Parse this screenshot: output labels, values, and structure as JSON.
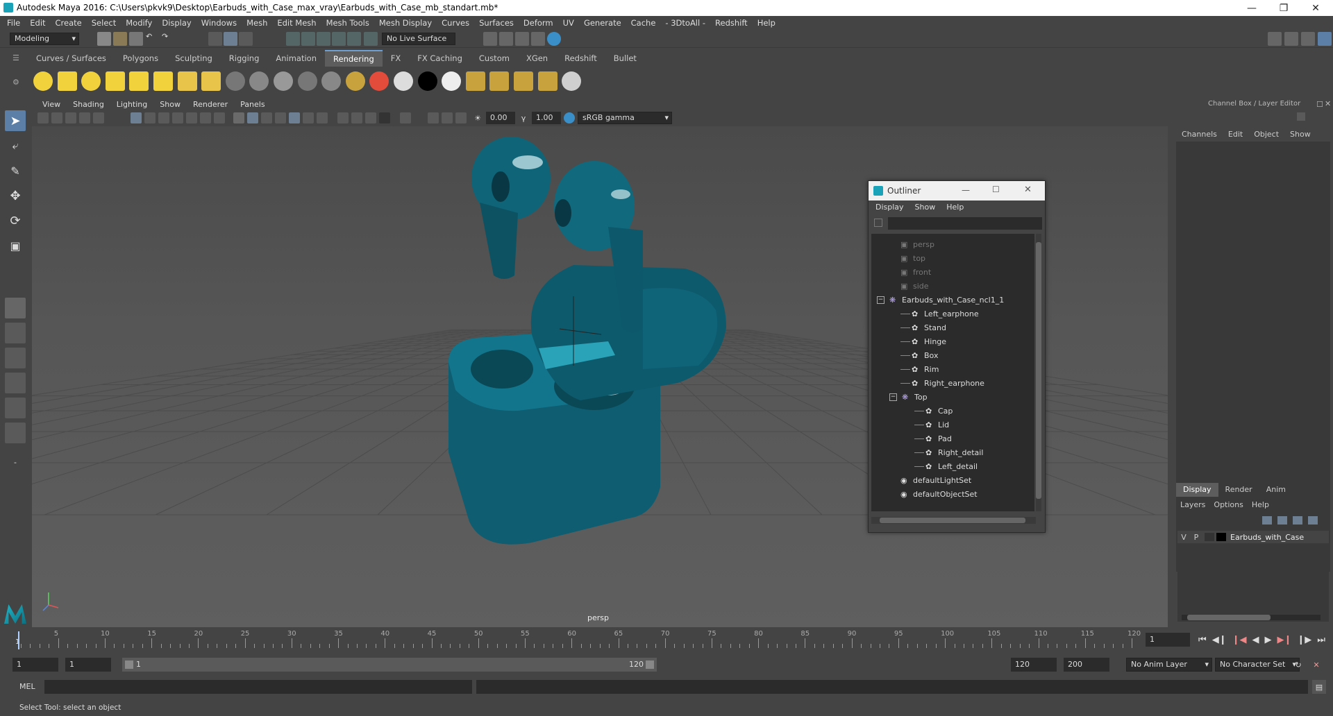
{
  "window": {
    "title": "Autodesk Maya 2016: C:\\Users\\pkvk9\\Desktop\\Earbuds_with_Case_max_vray\\Earbuds_with_Case_mb_standart.mb*",
    "min_icon": "minimize-icon",
    "max_icon": "maximize-icon",
    "close_icon": "close-icon"
  },
  "menubar": [
    "File",
    "Edit",
    "Create",
    "Select",
    "Modify",
    "Display",
    "Windows",
    "Mesh",
    "Edit Mesh",
    "Mesh Tools",
    "Mesh Display",
    "Curves",
    "Surfaces",
    "Deform",
    "UV",
    "Generate",
    "Cache",
    "- 3DtoAll -",
    "Redshift",
    "Help"
  ],
  "status": {
    "mode": "Modeling",
    "live_surface": "No Live Surface"
  },
  "shelf_tabs": [
    {
      "label": "Curves / Surfaces",
      "active": false
    },
    {
      "label": "Polygons",
      "active": false
    },
    {
      "label": "Sculpting",
      "active": false
    },
    {
      "label": "Rigging",
      "active": false
    },
    {
      "label": "Animation",
      "active": false
    },
    {
      "label": "Rendering",
      "active": true
    },
    {
      "label": "FX",
      "active": false
    },
    {
      "label": "FX Caching",
      "active": false
    },
    {
      "label": "Custom",
      "active": false
    },
    {
      "label": "XGen",
      "active": false
    },
    {
      "label": "Redshift",
      "active": false
    },
    {
      "label": "Bullet",
      "active": false
    }
  ],
  "viewport": {
    "menu": [
      "View",
      "Shading",
      "Lighting",
      "Show",
      "Renderer",
      "Panels"
    ],
    "exposure": "0.00",
    "gamma": "1.00",
    "color_space": "sRGB gamma",
    "camera_label": "persp",
    "model_color": "#0d5f73"
  },
  "outliner": {
    "title": "Outliner",
    "menu": [
      "Display",
      "Show",
      "Help"
    ],
    "items": [
      {
        "label": "persp",
        "depth": 1,
        "kind": "camera",
        "dim": true
      },
      {
        "label": "top",
        "depth": 1,
        "kind": "camera",
        "dim": true
      },
      {
        "label": "front",
        "depth": 1,
        "kind": "camera",
        "dim": true
      },
      {
        "label": "side",
        "depth": 1,
        "kind": "camera",
        "dim": true
      },
      {
        "label": "Earbuds_with_Case_ncl1_1",
        "depth": 0,
        "kind": "group",
        "dim": false
      },
      {
        "label": "Left_earphone",
        "depth": 2,
        "kind": "mesh",
        "dim": false
      },
      {
        "label": "Stand",
        "depth": 2,
        "kind": "mesh",
        "dim": false
      },
      {
        "label": "Hinge",
        "depth": 2,
        "kind": "mesh",
        "dim": false
      },
      {
        "label": "Box",
        "depth": 2,
        "kind": "mesh",
        "dim": false
      },
      {
        "label": "Rim",
        "depth": 2,
        "kind": "mesh",
        "dim": false
      },
      {
        "label": "Right_earphone",
        "depth": 2,
        "kind": "mesh",
        "dim": false
      },
      {
        "label": "Top",
        "depth": 1.5,
        "kind": "group",
        "dim": false
      },
      {
        "label": "Cap",
        "depth": 3,
        "kind": "mesh",
        "dim": false
      },
      {
        "label": "Lid",
        "depth": 3,
        "kind": "mesh",
        "dim": false
      },
      {
        "label": "Pad",
        "depth": 3,
        "kind": "mesh",
        "dim": false
      },
      {
        "label": "Right_detail",
        "depth": 3,
        "kind": "mesh",
        "dim": false
      },
      {
        "label": "Left_detail",
        "depth": 3,
        "kind": "mesh",
        "dim": false
      },
      {
        "label": "defaultLightSet",
        "depth": 1,
        "kind": "set",
        "dim": false
      },
      {
        "label": "defaultObjectSet",
        "depth": 1,
        "kind": "set",
        "dim": false
      }
    ]
  },
  "channel_box": {
    "title": "Channel Box / Layer Editor",
    "menu": [
      "Channels",
      "Edit",
      "Object",
      "Show"
    ],
    "layer_tabs": [
      "Display",
      "Render",
      "Anim"
    ],
    "layer_menu": [
      "Layers",
      "Options",
      "Help"
    ],
    "layer": {
      "v": "V",
      "p": "P",
      "name": "Earbuds_with_Case"
    }
  },
  "timeline": {
    "ticks": [
      5,
      10,
      15,
      20,
      25,
      30,
      35,
      40,
      45,
      50,
      55,
      60,
      65,
      70,
      75,
      80,
      85,
      90,
      95,
      100,
      105,
      110,
      115,
      120
    ],
    "first_label": "1",
    "current_frame": "1",
    "range_start": "1",
    "playback_start": "1",
    "range_bar_start": "1",
    "range_bar_end": "120",
    "playback_end": "120",
    "range_end": "200",
    "anim_layer": "No Anim Layer",
    "char_set": "No Character Set"
  },
  "command": {
    "lang": "MEL"
  },
  "help_text": "Select Tool: select an object"
}
